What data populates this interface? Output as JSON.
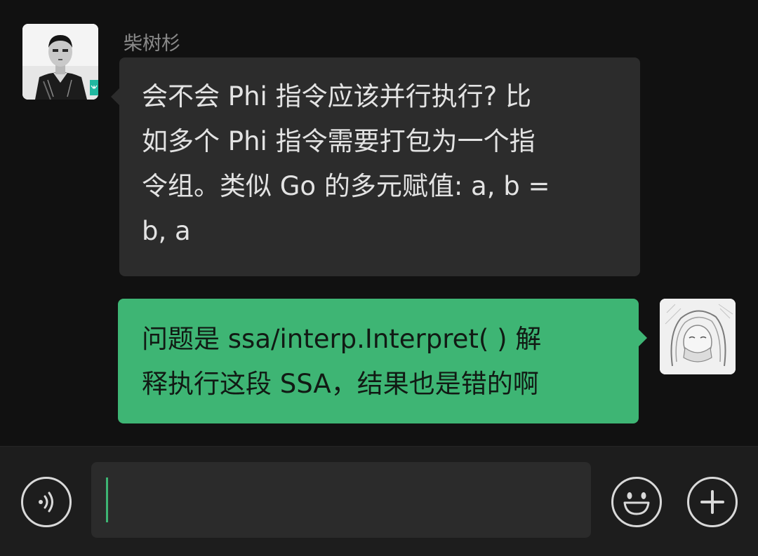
{
  "conversation": {
    "incoming": {
      "sender_name": "柴树杉",
      "avatar_icon": "person-photo-avatar",
      "lines": [
        "会不会 Phi 指令应该并行执行? 比",
        "如多个 Phi 指令需要打包为一个指",
        "令组。类似 Go 的多元赋值: a, b =",
        "b, a"
      ]
    },
    "outgoing": {
      "avatar_icon": "sketch-portrait-avatar",
      "lines": [
        "问题是 ssa/interp.Interpret( ) 解",
        "释执行这段 SSA，结果也是错的啊"
      ]
    }
  },
  "input_bar": {
    "voice_icon": "voice-mode-icon",
    "input_value": "",
    "emoji_icon": "emoji-icon",
    "more_icon": "plus-icon"
  },
  "colors": {
    "background": "#111111",
    "incoming_bubble": "#2c2c2c",
    "outgoing_bubble": "#3eb574",
    "input_bar": "#1d1d1d",
    "caret": "#3eb574"
  }
}
